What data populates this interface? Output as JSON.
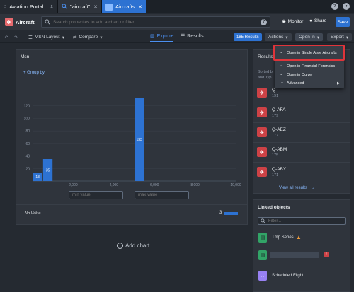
{
  "tabs": [
    {
      "label": "Aviation Portal",
      "icon": "portal-icon",
      "trailing": "⇕"
    },
    {
      "label": "\"aircraft\"",
      "icon": "search-icon",
      "trailing": "✕"
    },
    {
      "label": "Aircrafts",
      "icon": "object-icon",
      "trailing": "✕"
    }
  ],
  "header": {
    "title": "Aircraft",
    "search_placeholder": "Search properties to add a chart or filter...",
    "monitor": "Monitor",
    "share": "Share",
    "save": "Save"
  },
  "toolbar": {
    "layout": "MSN Layout",
    "compare": "Compare",
    "explore": "Explore",
    "results": "Results",
    "result_count": "185 Results",
    "actions": "Actions",
    "open_in": "Open in",
    "export": "Export"
  },
  "open_in_menu": [
    {
      "label": "Open in Single Aisle Aircrafts",
      "icon": "chart-icon"
    },
    {
      "label": "Open in Financial Forensics",
      "icon": "chart-icon"
    },
    {
      "label": "Open in Quiver",
      "icon": "chart-icon"
    },
    {
      "label": "Advanced",
      "icon": "more-icon"
    }
  ],
  "chart_card": {
    "title": "Msn",
    "group_by": "+ Group by",
    "min_placeholder": "min value",
    "max_placeholder": "max value",
    "range_dash": "–",
    "no_value_label": "No Value",
    "no_value_count": "3"
  },
  "chart_data": {
    "type": "bar",
    "xlim": [
      0,
      10000
    ],
    "ylim": [
      0,
      140
    ],
    "x_ticks": [
      2000,
      4000,
      6000,
      8000,
      10000
    ],
    "x_tick_labels": [
      "2,000",
      "4,000",
      "6,000",
      "8,000",
      "10,000"
    ],
    "y_ticks": [
      20,
      40,
      60,
      80,
      100,
      120
    ],
    "bars": [
      {
        "x_start": 0,
        "x_end": 500,
        "value": 13,
        "label": "13"
      },
      {
        "x_start": 500,
        "x_end": 1000,
        "value": 35,
        "label": "35"
      },
      {
        "x_start": 5000,
        "x_end": 5500,
        "value": 133,
        "label": "133"
      }
    ],
    "bar_color": "#2d72d2",
    "grid": true
  },
  "add_chart": "Add chart",
  "results_panel": {
    "title": "Results",
    "sorted_line1": "Sorted b",
    "sorted_line2": "and Typ",
    "items": [
      {
        "name": "Q-",
        "sub": "191"
      },
      {
        "name": "Q-AFA",
        "sub": "179"
      },
      {
        "name": "Q-AEZ",
        "sub": "177"
      },
      {
        "name": "Q-ABM",
        "sub": "175"
      },
      {
        "name": "Q-ABY",
        "sub": "171"
      }
    ],
    "view_all": "View all results"
  },
  "linked_objects": {
    "title": "Linked objects",
    "filter_placeholder": "Filter...",
    "items": [
      {
        "name": "Tmp Series",
        "icon": "document-icon",
        "color": "#32a467",
        "warning": true
      },
      {
        "name": "",
        "icon": "document-icon",
        "color": "#32a467",
        "error": true
      },
      {
        "name": "Scheduled Flight",
        "icon": "flight-icon",
        "color": "#9881f3"
      }
    ]
  }
}
